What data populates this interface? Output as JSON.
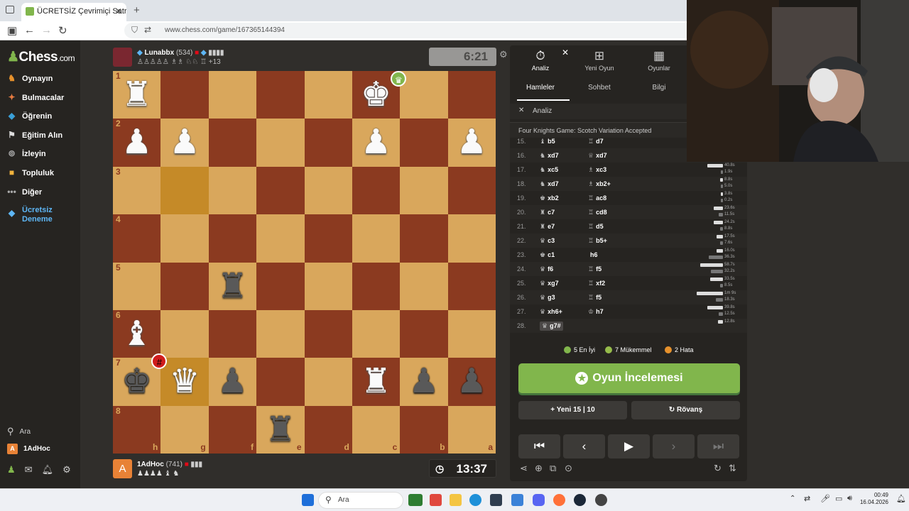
{
  "browser": {
    "tab_title": "ÜCRETSİZ Çevrimiçi Satranç Oy",
    "url": "www.chess.com/game/167365144394"
  },
  "sidebar": {
    "logo": "Chess",
    "logo_suffix": ".com",
    "items": [
      {
        "label": "Oynayın",
        "icon": "play-icon"
      },
      {
        "label": "Bulmacalar",
        "icon": "puzzle-icon"
      },
      {
        "label": "Öğrenin",
        "icon": "learn-icon"
      },
      {
        "label": "Eğitim Alın",
        "icon": "train-icon"
      },
      {
        "label": "İzleyin",
        "icon": "watch-icon"
      },
      {
        "label": "Topluluk",
        "icon": "community-icon"
      },
      {
        "label": "Diğer",
        "icon": "more-icon"
      }
    ],
    "trial_line1": "Ücretsiz",
    "trial_line2": "Deneme",
    "search_label": "Ara",
    "user_initial": "A",
    "user_name": "1AdHoc"
  },
  "top_player": {
    "name": "Lunabbx",
    "rating": "(534)",
    "captured_extra": "+13",
    "clock": "6:21"
  },
  "bottom_player": {
    "initial": "A",
    "name": "1AdHoc",
    "rating": "(741)",
    "clock": "13:37"
  },
  "board": {
    "ranks": [
      "1",
      "2",
      "3",
      "4",
      "5",
      "6",
      "7",
      "8"
    ],
    "files": [
      "h",
      "g",
      "f",
      "e",
      "d",
      "c",
      "b",
      "a"
    ],
    "highlight_squares": [
      "g3",
      "g7"
    ]
  },
  "panel": {
    "top_tabs": [
      {
        "label": "Analiz",
        "icon": "stopwatch-icon"
      },
      {
        "label": "Yeni Oyun",
        "icon": "plus-box-icon"
      },
      {
        "label": "Oyunlar",
        "icon": "board-icon"
      }
    ],
    "sub_tabs": [
      "Hamleler",
      "Sohbet",
      "Bilgi"
    ],
    "analysis_label": "Analiz",
    "opening": "Four Knights Game: Scotch Variation Accepted",
    "moves": [
      {
        "n": "15.",
        "w": "b5",
        "wg": "♝",
        "b": "d7",
        "bg": "♖"
      },
      {
        "n": "16.",
        "w": "xd7",
        "wg": "♞",
        "b": "xd7",
        "bg": "♕"
      },
      {
        "n": "17.",
        "w": "xc5",
        "wg": "♞",
        "b": "xc3",
        "bg": "♗"
      },
      {
        "n": "18.",
        "w": "xd7",
        "wg": "♞",
        "b": "xb2+",
        "bg": "♗"
      },
      {
        "n": "19.",
        "w": "xb2",
        "wg": "♚",
        "b": "ac8",
        "bg": "♖"
      },
      {
        "n": "20.",
        "w": "c7",
        "wg": "♜",
        "b": "cd8",
        "bg": "♖"
      },
      {
        "n": "21.",
        "w": "e7",
        "wg": "♜",
        "b": "d5",
        "bg": "♖"
      },
      {
        "n": "22.",
        "w": "c3",
        "wg": "♛",
        "b": "b5+",
        "bg": "♖"
      },
      {
        "n": "23.",
        "w": "c1",
        "wg": "♚",
        "b": "h6",
        "bg": ""
      },
      {
        "n": "24.",
        "w": "f6",
        "wg": "♛",
        "b": "f5",
        "bg": "♖"
      },
      {
        "n": "25.",
        "w": "xg7",
        "wg": "♛",
        "b": "xf2",
        "bg": "♖"
      },
      {
        "n": "26.",
        "w": "g3",
        "wg": "♛",
        "b": "f5",
        "bg": "♖"
      },
      {
        "n": "27.",
        "w": "xh6+",
        "wg": "♛",
        "b": "h7",
        "bg": "♔"
      },
      {
        "n": "28.",
        "w": "g7#",
        "wg": "♛",
        "b": "",
        "bg": ""
      }
    ],
    "times": [
      {
        "w": "40.8s",
        "b": "1.9s",
        "wf": 0.35,
        "bf": 0.02
      },
      {
        "w": "8.8s",
        "b": "5.0s",
        "wf": 0.07,
        "bf": 0.04
      },
      {
        "w": "3.8s",
        "b": "0.2s",
        "wf": 0.03,
        "bf": 0.01
      },
      {
        "w": "23.6s",
        "b": "11.5s",
        "wf": 0.2,
        "bf": 0.1
      },
      {
        "w": "24.2s",
        "b": "8.8s",
        "wf": 0.21,
        "bf": 0.07
      },
      {
        "w": "17.5s",
        "b": "7.6s",
        "wf": 0.15,
        "bf": 0.06
      },
      {
        "w": "16.0s",
        "b": "36.3s",
        "wf": 0.14,
        "bf": 0.31
      },
      {
        "w": "58.7s",
        "b": "32.2s",
        "wf": 0.5,
        "bf": 0.27
      },
      {
        "w": "33.5s",
        "b": "8.5s",
        "wf": 0.28,
        "bf": 0.07
      },
      {
        "w": "1m 9s",
        "b": "18.3s",
        "wf": 0.58,
        "bf": 0.16
      },
      {
        "w": "39.8s",
        "b": "12.5s",
        "wf": 0.34,
        "bf": 0.1
      },
      {
        "w": "12.8s",
        "b": "",
        "wf": 0.11,
        "bf": 0
      }
    ],
    "stats": [
      {
        "label": "5 En İyi",
        "color": "#81b64c"
      },
      {
        "label": "7 Mükemmel",
        "color": "#96bc4b"
      },
      {
        "label": "2 Hata",
        "color": "#e6912c"
      }
    ],
    "review_button": "Oyun İncelemesi",
    "new_button": "Yeni 15 | 10",
    "rematch_button": "Rövanş"
  },
  "taskbar": {
    "search": "Ara",
    "time": "00:49",
    "date": "16.04.2026"
  }
}
